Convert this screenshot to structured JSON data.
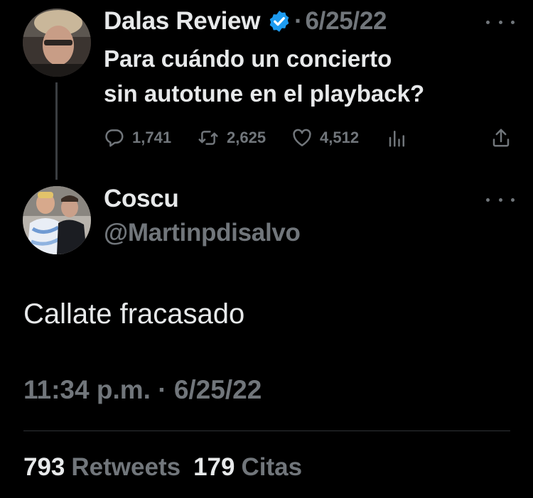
{
  "parent_tweet": {
    "author_name": "Dalas Review",
    "separator": "·",
    "date": "6/25/22",
    "text": "Para cuándo un concierto\nsin autotune en el playback?",
    "replies": "1,741",
    "retweets": "2,625",
    "likes": "4,512",
    "icons": [
      "reply-icon",
      "retweet-icon",
      "like-icon",
      "analytics-icon",
      "share-icon",
      "verified-badge-icon",
      "more-options-icon"
    ]
  },
  "reply_tweet": {
    "author_name": "Coscu",
    "handle": "@Martinpdisalvo",
    "text": "Callate fracasado",
    "time": "11:34 p.m.",
    "separator": "·",
    "date": "6/25/22",
    "retweets_count": "793",
    "retweets_label": "Retweets",
    "quotes_count": "179",
    "quotes_label": "Citas"
  },
  "colors": {
    "background": "#000000",
    "text": "#e7e9ea",
    "muted": "#71767b",
    "verified": "#1d9bf0",
    "divider": "#2f3336"
  }
}
